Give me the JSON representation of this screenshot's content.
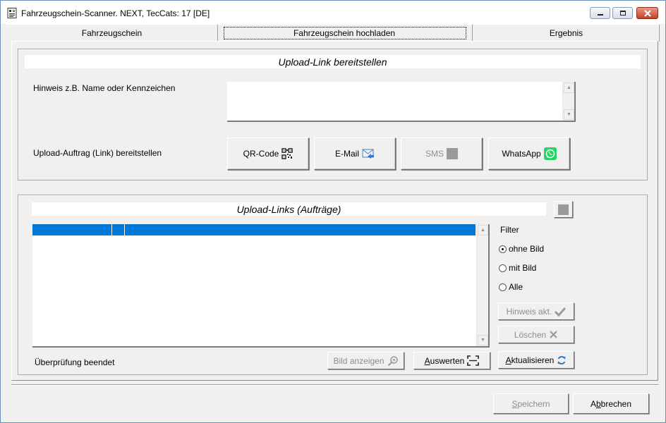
{
  "window": {
    "title": "Fahrzeugschein-Scanner. NEXT, TecCats: 17 [DE]"
  },
  "tabs": [
    {
      "label": "Fahrzeugschein"
    },
    {
      "label": "Fahrzeugschein hochladen"
    },
    {
      "label": "Ergebnis"
    }
  ],
  "upload_link": {
    "title": "Upload-Link bereitstellen",
    "hint_label": "Hinweis z.B. Name oder Kennzeichen",
    "hint_value": "",
    "order_label": "Upload-Auftrag (Link) bereitstellen",
    "buttons": {
      "qr": "QR-Code",
      "email": "E-Mail",
      "sms": "SMS",
      "whatsapp": "WhatsApp"
    }
  },
  "upload_links": {
    "title": "Upload-Links (Aufträge)",
    "filter_label": "Filter",
    "filters": [
      {
        "label": "ohne Bild",
        "checked": true
      },
      {
        "label": "mit Bild",
        "checked": false
      },
      {
        "label": "Alle",
        "checked": false
      }
    ],
    "buttons": {
      "hint_update": "Hinweis akt.",
      "delete": "Löschen",
      "refresh": "Aktualisieren",
      "show_image": "Bild anzeigen",
      "evaluate": "Auswerten"
    },
    "status": "Überprüfung beendet"
  },
  "footer": {
    "save": "Speichern",
    "cancel": "Abbrechen"
  },
  "colors": {
    "selection": "#0078d7",
    "whatsapp": "#25d366",
    "close_button": "#c4402a"
  }
}
